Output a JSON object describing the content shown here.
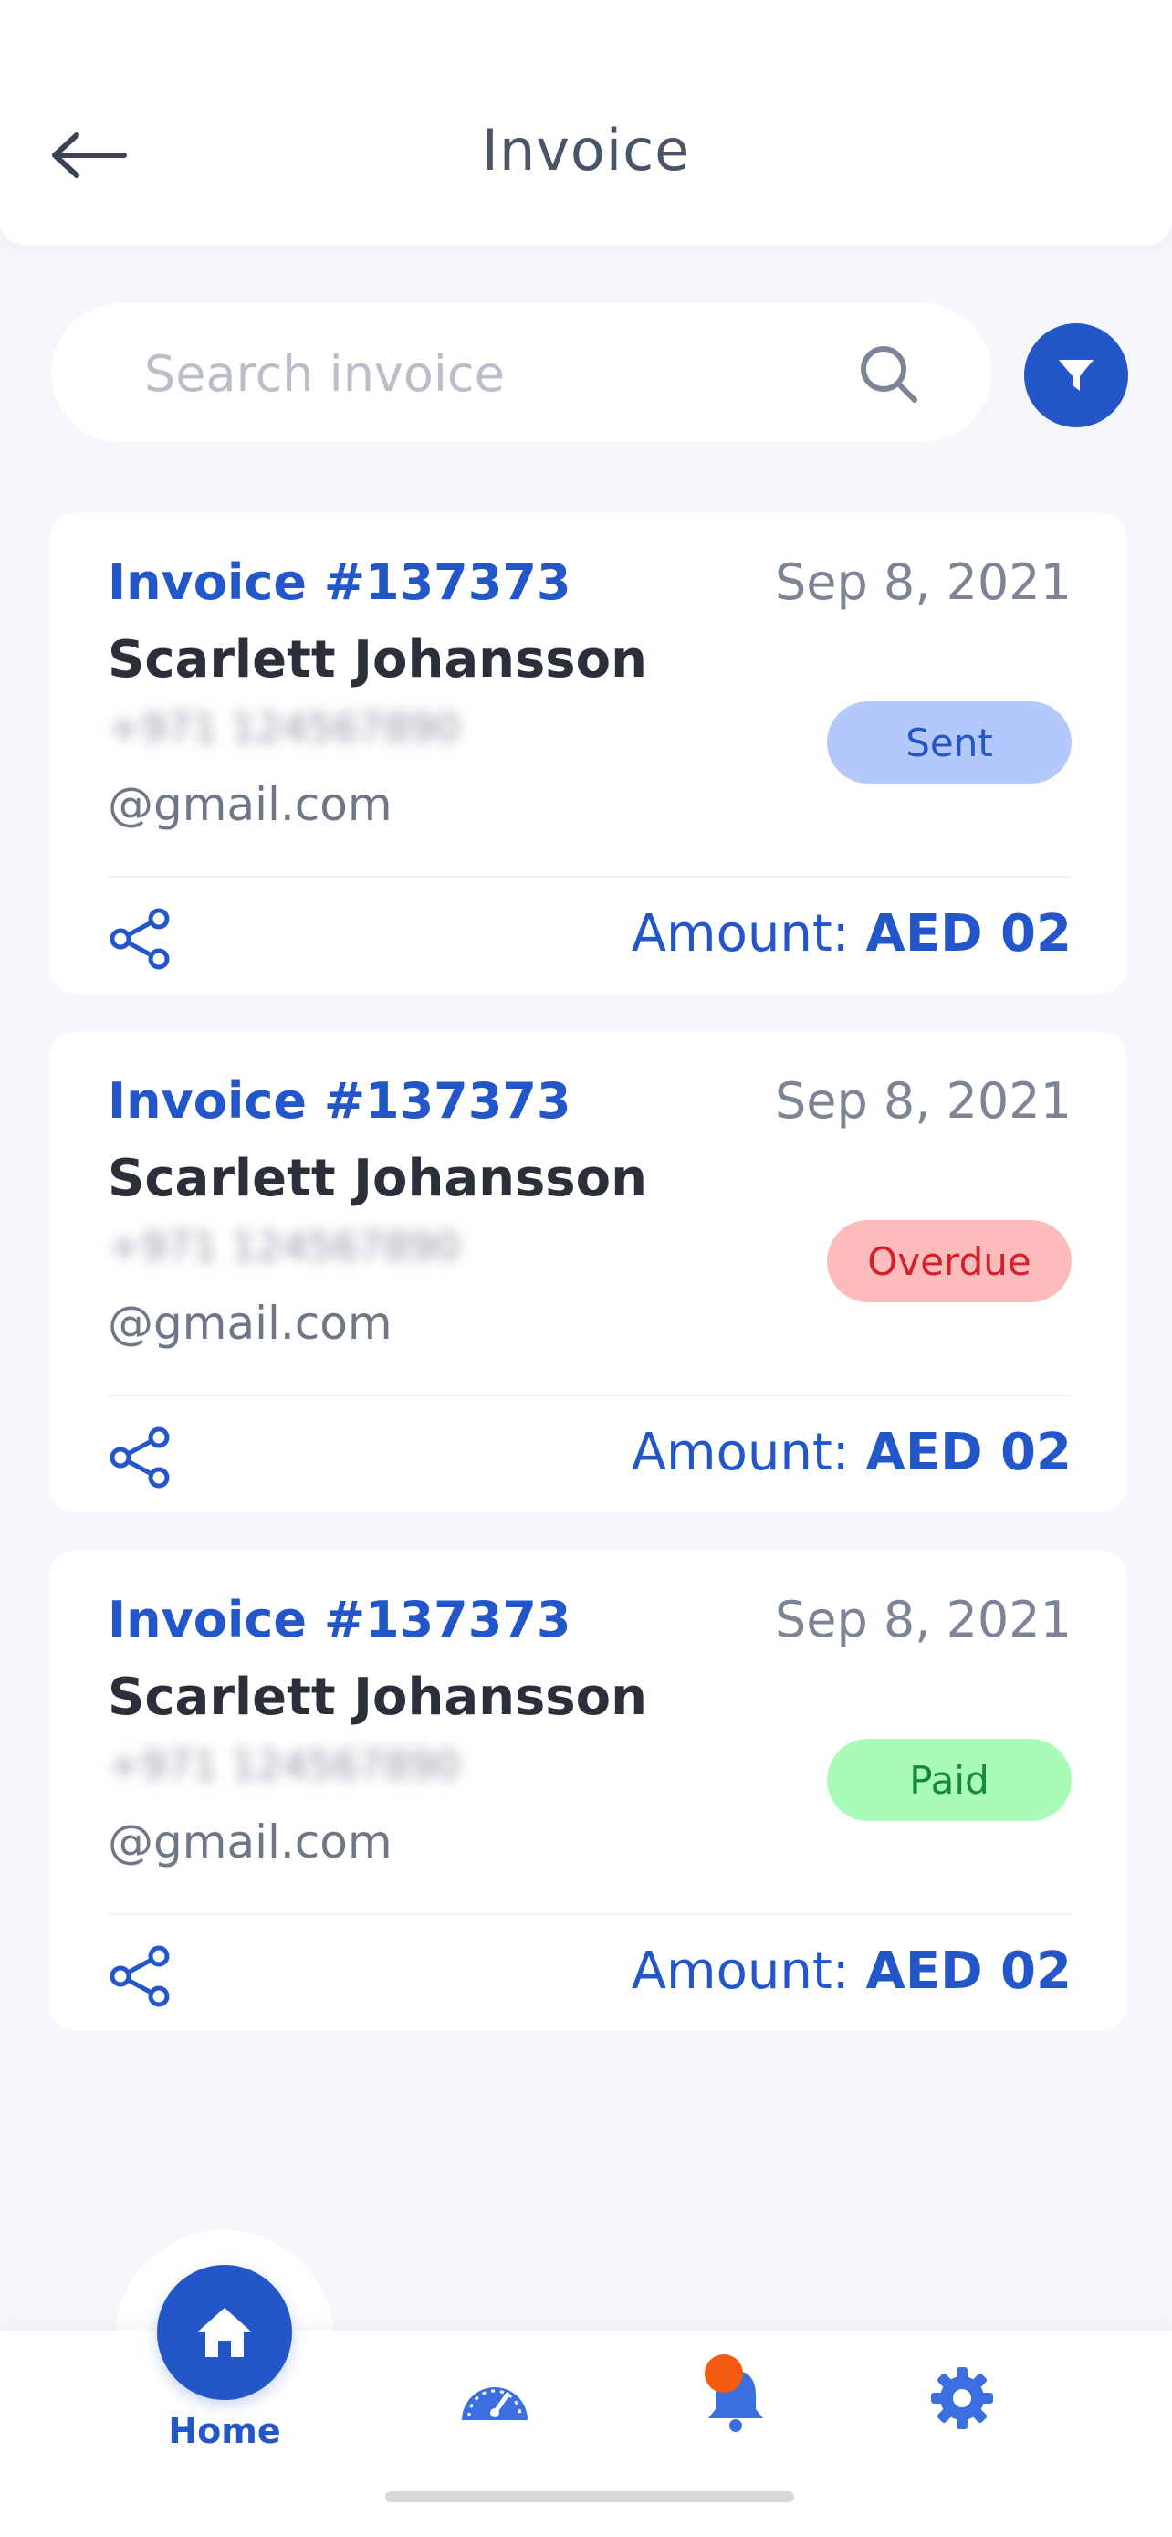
{
  "header": {
    "title": "Invoice",
    "back_icon": "arrow-left-icon"
  },
  "search": {
    "placeholder": "Search invoice",
    "value": "",
    "icon": "search-icon"
  },
  "filter": {
    "icon": "filter-icon",
    "color": "#2357c9"
  },
  "invoices": [
    {
      "invoice_no": "Invoice #137373",
      "date": "Sep 8, 2021",
      "customer": "Scarlett Johansson",
      "phone": "+971 124567890",
      "email": "@gmail.com",
      "status": "Sent",
      "status_bg": "#b4c8fb",
      "status_fg": "#2357c9",
      "amount_label": "Amount:",
      "amount_value": "AED 02"
    },
    {
      "invoice_no": "Invoice #137373",
      "date": "Sep 8, 2021",
      "customer": "Scarlett Johansson",
      "phone": "+971 124567890",
      "email": "@gmail.com",
      "status": "Overdue",
      "status_bg": "#fdbcbc",
      "status_fg": "#d4202a",
      "amount_label": "Amount:",
      "amount_value": "AED 02"
    },
    {
      "invoice_no": "Invoice #137373",
      "date": "Sep 8, 2021",
      "customer": "Scarlett Johansson",
      "phone": "+971 124567890",
      "email": "@gmail.com",
      "status": "Paid",
      "status_bg": "#a8fbb8",
      "status_fg": "#178a3a",
      "amount_label": "Amount:",
      "amount_value": "AED 02"
    }
  ],
  "bottom_nav": {
    "home_label": "Home",
    "items": [
      "home-icon",
      "speedometer-icon",
      "bell-icon",
      "gear-icon"
    ],
    "accent": "#2357c9",
    "notification_dot_color": "#f45b11"
  }
}
